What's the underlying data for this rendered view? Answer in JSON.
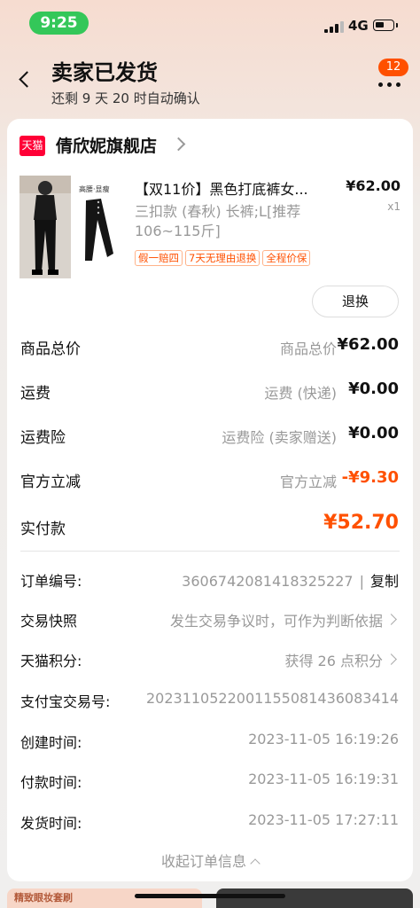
{
  "status_bar": {
    "time": "9:25",
    "network": "4G"
  },
  "header": {
    "title": "卖家已发货",
    "subtitle": "还剩 9 天 20 时自动确认",
    "badge_count": "12"
  },
  "shop": {
    "platform_logo": "天猫",
    "name": "倩欣妮旗舰店"
  },
  "product": {
    "title": "【双11价】黑色打底裤女...",
    "sku": "三扣款 (春秋) 长裤;L[推荐106~115斤]",
    "image_caption": "高腰·显瘦",
    "price": "¥62.00",
    "quantity": "x1",
    "tags": [
      "假一赔四",
      "7天无理由退换",
      "全程价保"
    ],
    "refund_label": "退换"
  },
  "pricing": [
    {
      "label": "商品总价",
      "desc": "商品总价",
      "amount": "¥62.00"
    },
    {
      "label": "运费",
      "desc": "运费 (快递)",
      "amount": "¥0.00"
    },
    {
      "label": "运费险",
      "desc": "运费险 (卖家赠送)",
      "amount": "¥0.00"
    },
    {
      "label": "官方立减",
      "desc": "官方立减",
      "amount": "-¥9.30"
    },
    {
      "label": "实付款",
      "desc": "",
      "amount": "¥52.70"
    }
  ],
  "order_info": {
    "order_no_label": "订单编号:",
    "order_no": "3606742081418325227",
    "copy_label": "复制",
    "snapshot_label": "交易快照",
    "snapshot_value": "发生交易争议时，可作为判断依据",
    "points_label": "天猫积分:",
    "points_value": "获得 26 点积分",
    "alipay_label": "支付宝交易号:",
    "alipay_value": "2023110522001155081436083414",
    "created_label": "创建时间:",
    "created_value": "2023-11-05 16:19:26",
    "paid_label": "付款时间:",
    "paid_value": "2023-11-05 16:19:31",
    "shipped_label": "发货时间:",
    "shipped_value": "2023-11-05 17:27:11",
    "collapse_label": "收起订单信息"
  },
  "bottom_banner": {
    "left_text": "精致眼妆套刷"
  },
  "colors": {
    "accent": "#ff5000",
    "tmall_red": "#ff0036",
    "status_green": "#34c759"
  }
}
